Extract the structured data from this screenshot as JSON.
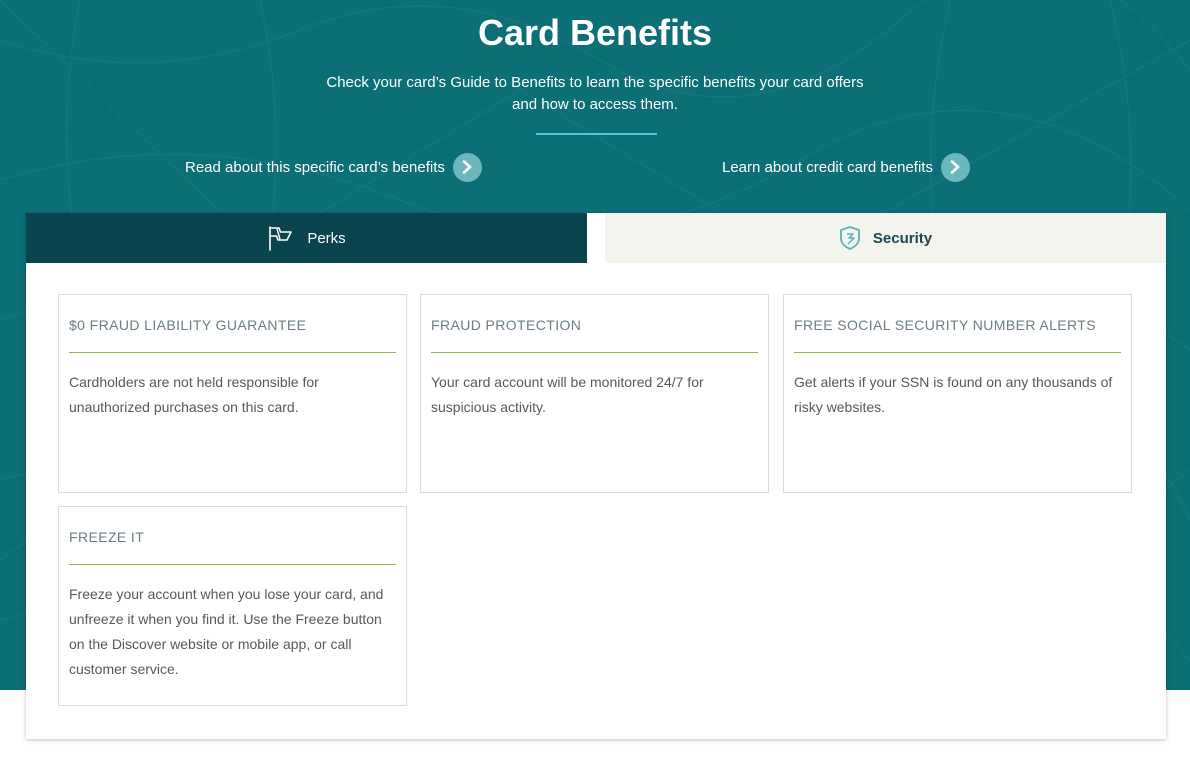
{
  "header": {
    "title": "Card Benefits",
    "subtitle_line1": "Check your card’s Guide to Benefits to learn the specific benefits your card offers",
    "subtitle_line2": "and how to access them.",
    "links": [
      {
        "label": "Read about this specific card’s benefits",
        "icon": "chevron-right-icon"
      },
      {
        "label": "Learn about credit card benefits",
        "icon": "chevron-right-icon"
      }
    ]
  },
  "tabs": [
    {
      "label": "Perks",
      "icon": "flag-icon",
      "active": true
    },
    {
      "label": "Security",
      "icon": "shield-icon",
      "active": false
    }
  ],
  "benefits": [
    {
      "title": "$0 FRAUD LIABILITY GUARANTEE",
      "description": "Cardholders are not held responsible for unauthorized purchases on this card."
    },
    {
      "title": "FRAUD PROTECTION",
      "description": "Your card account will be monitored 24/7 for suspicious activity."
    },
    {
      "title": "FREE SOCIAL SECURITY NUMBER ALERTS",
      "description": "Get alerts if your SSN is found on any thousands of risky websites."
    },
    {
      "title": "FREEZE IT",
      "description": "Freeze your account when you lose your card, and unfreeze it when you find it. Use the Freeze button on the Discover website or mobile app, or call customer service."
    }
  ],
  "colors": {
    "hero_background": "#0b6f75",
    "active_tab": "#0a454f",
    "inactive_tab": "#f4f4ee",
    "accent_rule": "#8cbc4e",
    "link_circle": "#6ab8be"
  }
}
